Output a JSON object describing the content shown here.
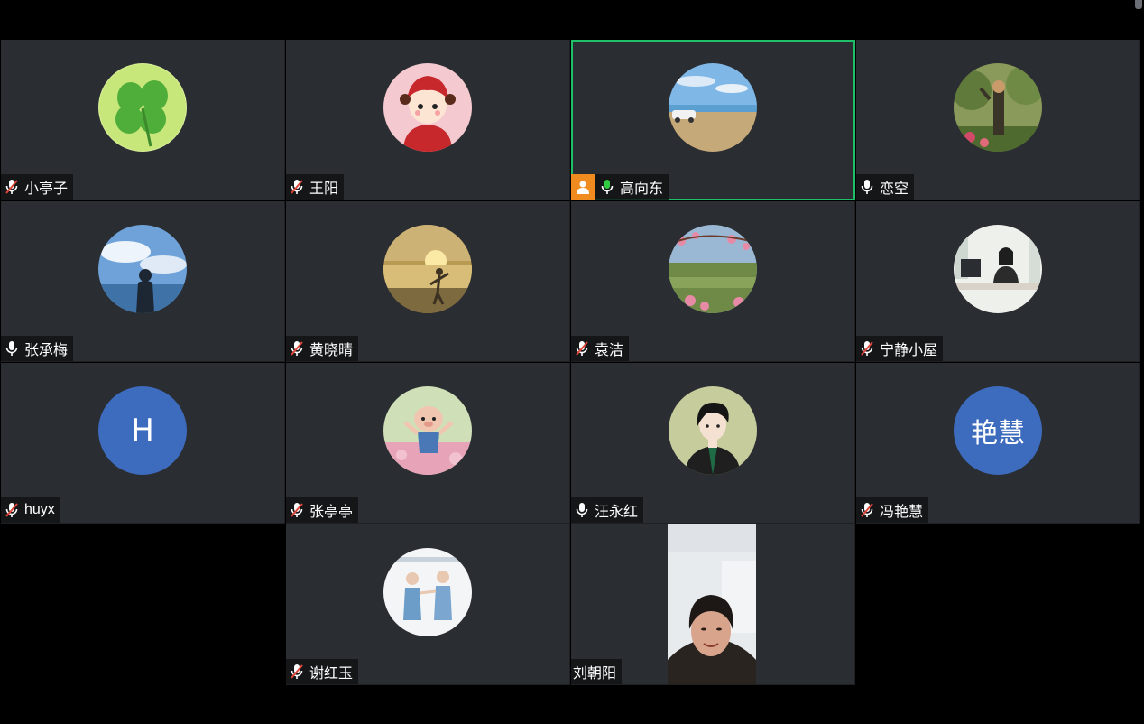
{
  "colors": {
    "accent_active": "#1fbf6a",
    "host_badge": "#f08c1f",
    "muted_slash": "#e0453a",
    "speaking_mic": "#2ecc40",
    "initials_bg": "#3d6bbd"
  },
  "participants": [
    {
      "name": "小亭子",
      "mic": "muted",
      "avatar_icon": "clover-avatar-icon"
    },
    {
      "name": "王阳",
      "mic": "muted",
      "avatar_icon": "cartoon-girl-avatar-icon"
    },
    {
      "name": "高向东",
      "mic": "speaking",
      "host": true,
      "active": true,
      "avatar_icon": "beach-avatar-icon"
    },
    {
      "name": "恋空",
      "mic": "on",
      "avatar_icon": "garden-avatar-icon"
    },
    {
      "name": "张承梅",
      "mic": "on",
      "avatar_icon": "sky-silhouette-avatar-icon"
    },
    {
      "name": "黄晓晴",
      "mic": "muted",
      "avatar_icon": "sunset-beach-avatar-icon"
    },
    {
      "name": "袁洁",
      "mic": "muted",
      "avatar_icon": "blossom-field-avatar-icon"
    },
    {
      "name": "宁静小屋",
      "mic": "muted",
      "avatar_icon": "office-woman-avatar-icon"
    },
    {
      "name": "huyx",
      "mic": "muted",
      "initials": "H"
    },
    {
      "name": "张亭亭",
      "mic": "muted",
      "avatar_icon": "cartoon-pig-avatar-icon"
    },
    {
      "name": "汪永红",
      "mic": "on",
      "avatar_icon": "cartoon-woman-avatar-icon"
    },
    {
      "name": "冯艳慧",
      "mic": "muted",
      "initials": "艳慧"
    },
    {
      "name": "谢红玉",
      "mic": "muted",
      "avatar_icon": "couple-photo-avatar-icon"
    },
    {
      "name": "刘朝阳",
      "mic": "none",
      "video": true,
      "avatar_icon": "live-video-feed-icon"
    }
  ]
}
